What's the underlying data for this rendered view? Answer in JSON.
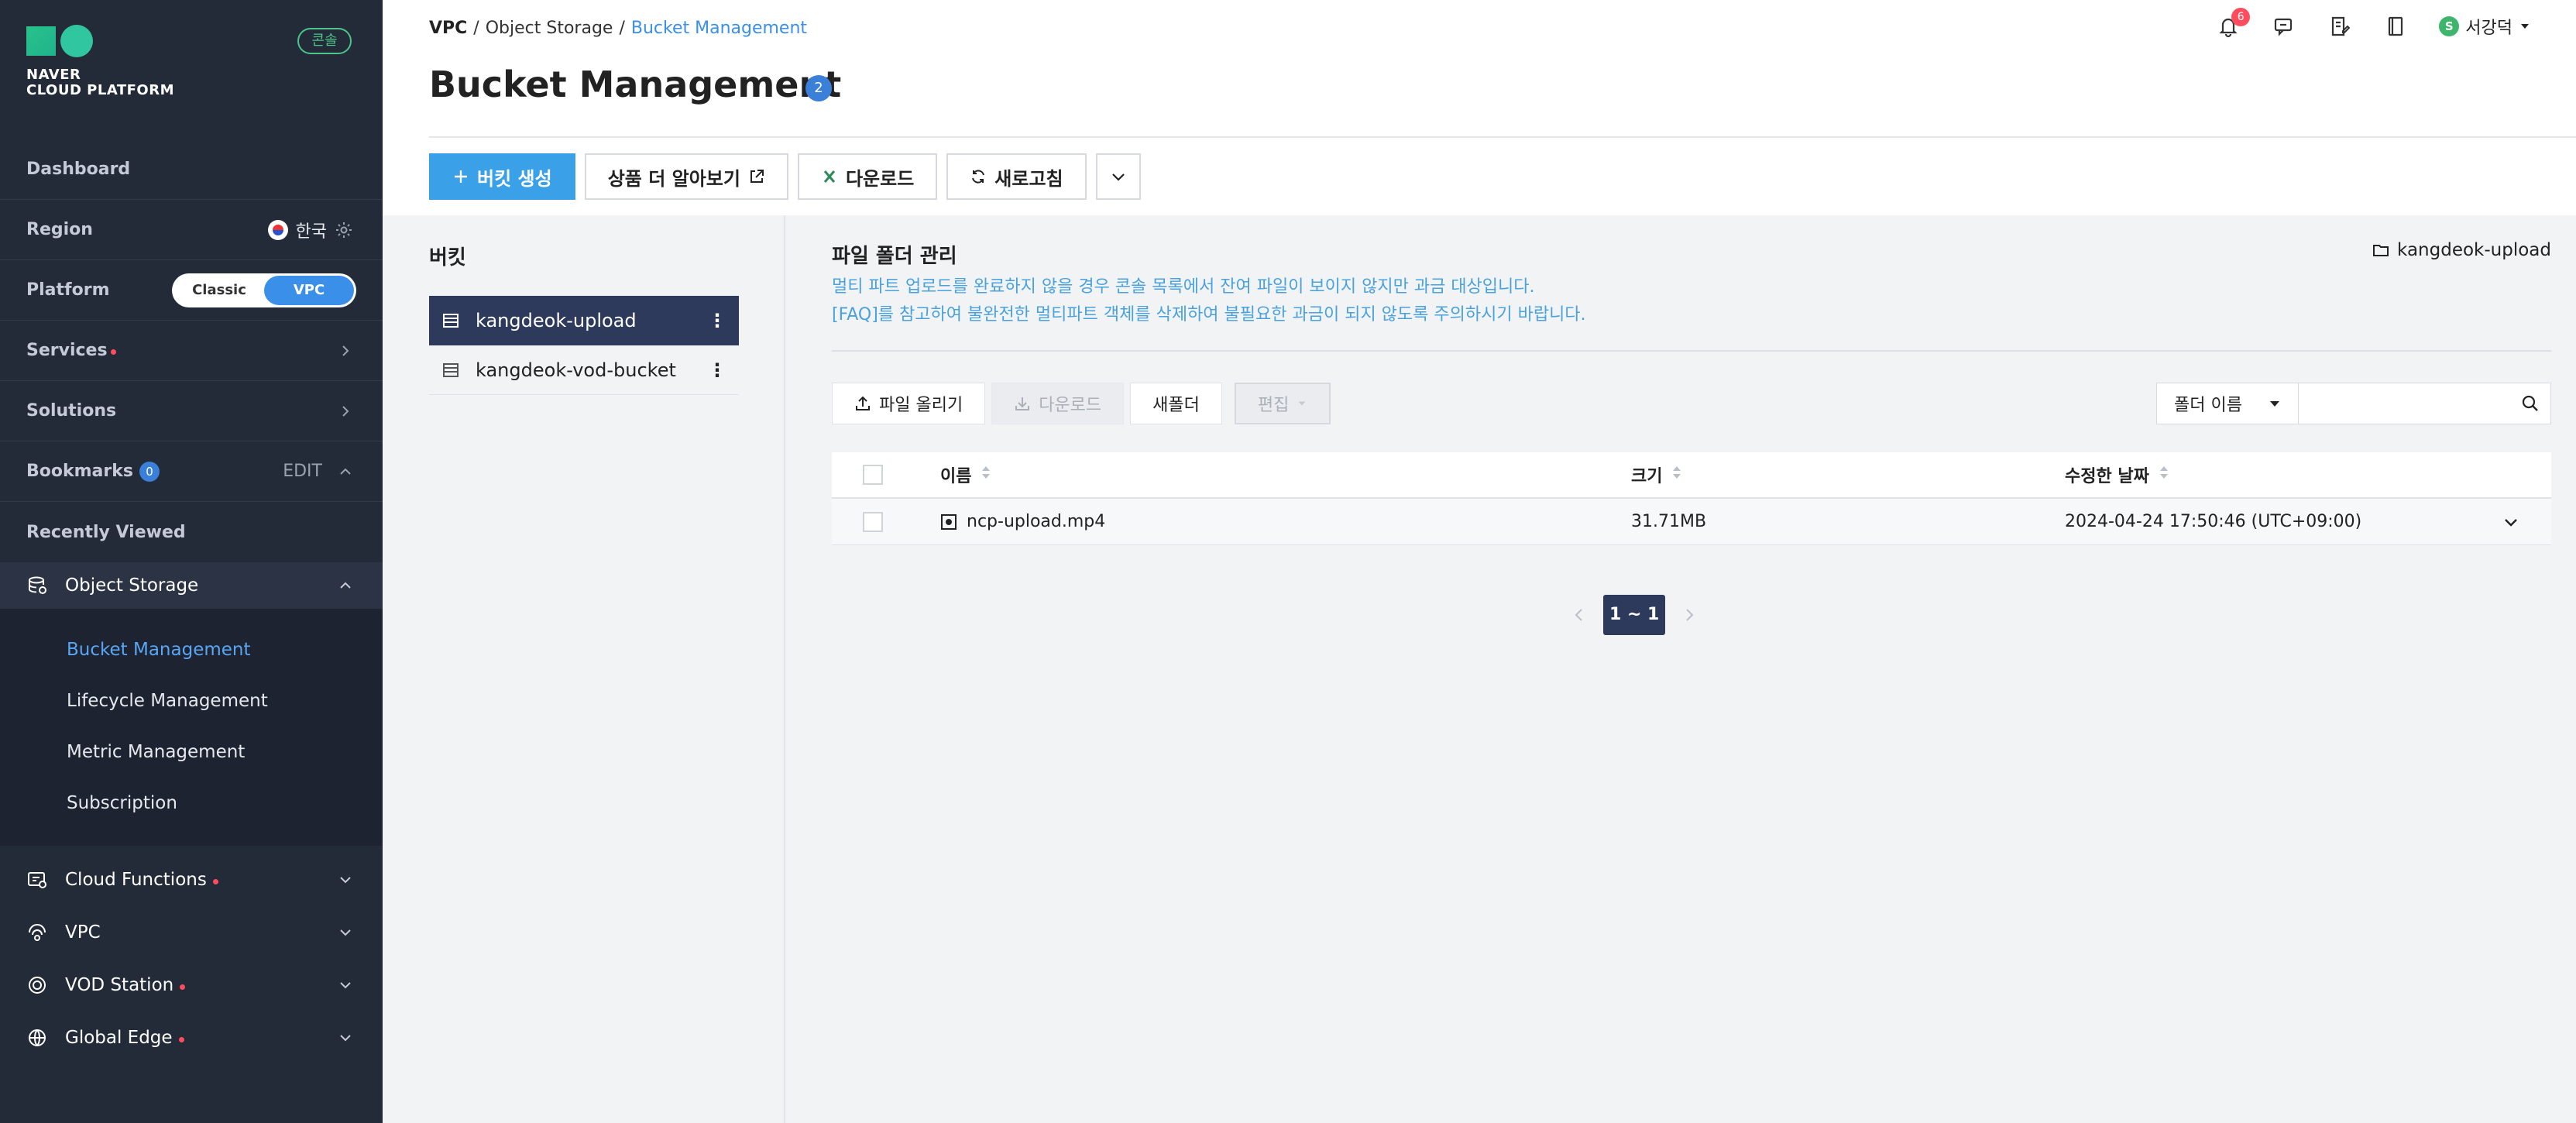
{
  "sidebar": {
    "logo_line1": "NAVER",
    "logo_line2": "CLOUD PLATFORM",
    "console_badge": "콘솔",
    "dashboard": "Dashboard",
    "region_label": "Region",
    "region_value": "한국",
    "platform_label": "Platform",
    "platform_options": [
      "Classic",
      "VPC"
    ],
    "platform_selected": "VPC",
    "services": "Services",
    "solutions": "Solutions",
    "bookmarks": "Bookmarks",
    "bookmarks_count": "0",
    "bookmarks_edit": "EDIT",
    "recently_viewed": "Recently Viewed",
    "object_storage": "Object Storage",
    "object_storage_items": [
      "Bucket Management",
      "Lifecycle Management",
      "Metric Management",
      "Subscription"
    ],
    "active_item": "Bucket Management",
    "services_list": [
      "Cloud Functions",
      "VPC",
      "VOD Station",
      "Global Edge"
    ]
  },
  "header": {
    "breadcrumb": [
      "VPC",
      "Object Storage",
      "Bucket Management"
    ],
    "title": "Bucket Management",
    "title_count": "2",
    "notification_count": "6",
    "user_initial": "S",
    "user_name": "서강덕"
  },
  "toolbar": {
    "create_bucket": "버킷 생성",
    "learn_more": "상품 더 알아보기",
    "download": "다운로드",
    "refresh": "새로고침"
  },
  "buckets": {
    "title": "버킷",
    "items": [
      "kangdeok-upload",
      "kangdeok-vod-bucket"
    ],
    "selected": "kangdeok-upload"
  },
  "file_manager": {
    "title": "파일 폴더 관리",
    "note1": "멀티 파트 업로드를 완료하지 않을 경우 콘솔 목록에서 잔여 파일이 보이지 않지만 과금 대상입니다.",
    "note2": "[FAQ]를 참고하여 불완전한 멀티파트 객체를 삭제하여 불필요한 과금이 되지 않도록 주의하시기 바랍니다.",
    "path": "kangdeok-upload",
    "upload": "파일 올리기",
    "download": "다운로드",
    "new_folder": "새폴더",
    "edit": "편집",
    "search_select": "폴더 이름",
    "search_placeholder": "",
    "columns": [
      "이름",
      "크기",
      "수정한 날짜"
    ],
    "rows": [
      {
        "name": "ncp-upload.mp4",
        "size": "31.71MB",
        "modified": "2024-04-24 17:50:46 (UTC+09:00)"
      }
    ],
    "pagination": "1 ~ 1"
  },
  "colors": {
    "sidebar_bg": "#232a38",
    "accent": "#3a8fe8",
    "selected_bucket": "#2e3a5c",
    "note_text": "#4aa2dd"
  }
}
